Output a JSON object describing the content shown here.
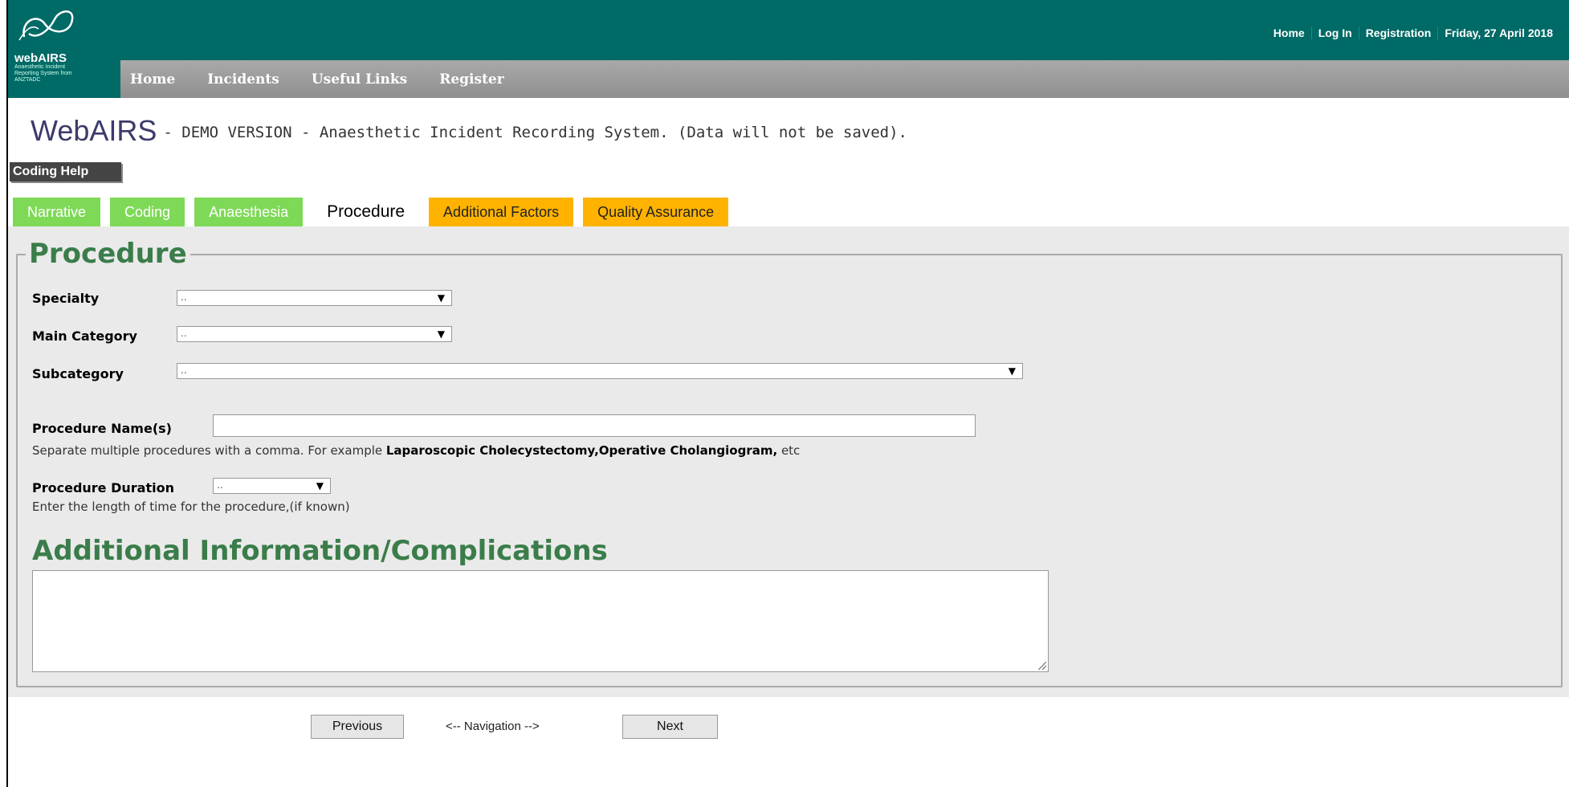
{
  "brand": {
    "logo_text": "webAIRS",
    "logo_sub": "Anaesthetic Incident Reporting System from ANZTADC"
  },
  "top_links": [
    "Home",
    "Log In",
    "Registration",
    "Friday, 27 April 2018"
  ],
  "nav": [
    "Home",
    "Incidents",
    "Useful Links",
    "Register"
  ],
  "title": "WebAIRS",
  "subtitle": "- DEMO VERSION - Anaesthetic Incident Recording System. (Data will not be saved).",
  "coding_help": "Coding Help",
  "tabs": [
    {
      "label": "Narrative",
      "state": "green"
    },
    {
      "label": "Coding",
      "state": "green"
    },
    {
      "label": "Anaesthesia",
      "state": "green"
    },
    {
      "label": "Procedure",
      "state": "active"
    },
    {
      "label": "Additional Factors",
      "state": "orange"
    },
    {
      "label": "Quality Assurance",
      "state": "orange"
    }
  ],
  "form": {
    "legend": "Procedure",
    "specialty_label": "Specialty",
    "specialty_value": "..",
    "main_category_label": "Main Category",
    "main_category_value": "..",
    "subcategory_label": "Subcategory",
    "subcategory_value": "..",
    "procedure_name_label": "Procedure Name(s)",
    "procedure_name_value": "",
    "procedure_help_prefix": "Separate multiple procedures with a comma. For example ",
    "procedure_help_example": "Laparoscopic Cholecystectomy,Operative Cholangiogram,",
    "procedure_help_suffix": " etc",
    "duration_label": "Procedure Duration",
    "duration_value": "..",
    "duration_help": "Enter the length of time for the procedure,(if known)",
    "additional_heading": "Additional Information/Complications",
    "additional_value": ""
  },
  "navigation": {
    "previous": "Previous",
    "middle": "<-- Navigation -->",
    "next": "Next"
  },
  "icons": {
    "logo": "infinity-logo-icon",
    "dropdown": "triangle-down-icon"
  },
  "colors": {
    "header": "#006a66",
    "tab_done": "#7ed957",
    "tab_pending": "#ffb300",
    "heading_green": "#3a7d4a"
  }
}
